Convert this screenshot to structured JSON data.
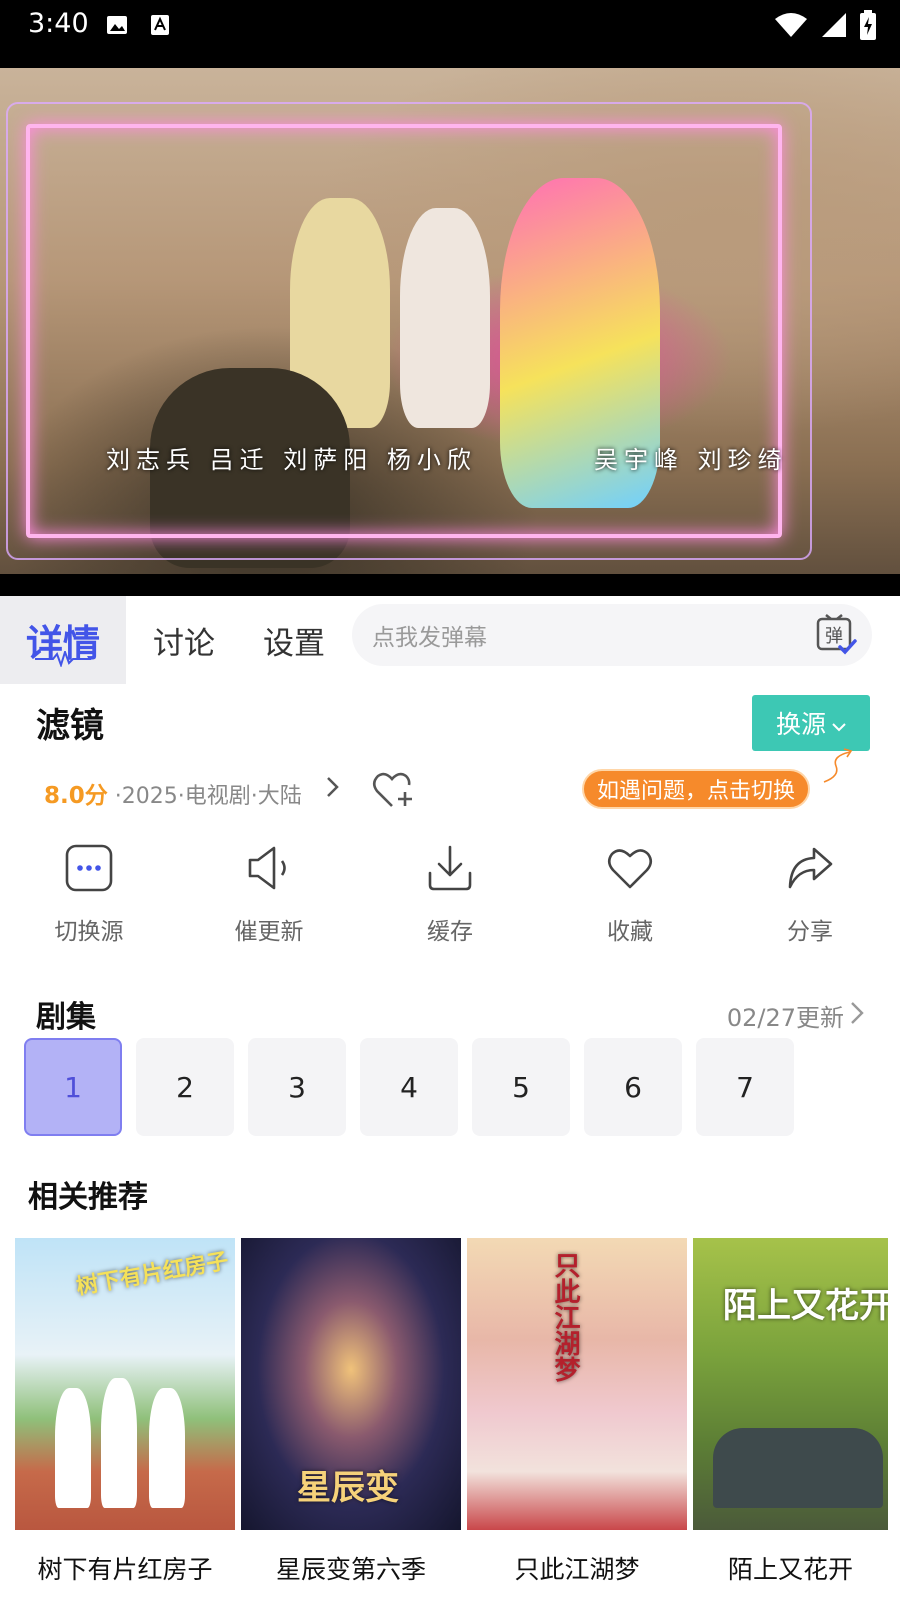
{
  "status_bar": {
    "time": "3:40",
    "icons": [
      "image-icon",
      "text-a-icon",
      "wifi-icon",
      "signal-icon",
      "battery-charging-icon"
    ]
  },
  "video": {
    "subtitle_left": "刘志兵 吕迁 刘萨阳 杨小欣",
    "subtitle_right": "吴宇峰 刘珍绮"
  },
  "tabs": {
    "details": "详情",
    "discuss": "讨论",
    "settings": "设置",
    "danmu_placeholder": "点我发弹幕",
    "danmu_icon_char": "弹"
  },
  "detail": {
    "title": "滤镜",
    "switch_source_label": "换源",
    "score": "8.0分",
    "meta": " ·2025·电视剧·大陆",
    "tip": "如遇问题，点击切换"
  },
  "actions": [
    {
      "label": "切换源",
      "icon": "more-dots-icon"
    },
    {
      "label": "催更新",
      "icon": "speaker-icon"
    },
    {
      "label": "缓存",
      "icon": "download-icon"
    },
    {
      "label": "收藏",
      "icon": "heart-icon"
    },
    {
      "label": "分享",
      "icon": "share-icon"
    }
  ],
  "episodes": {
    "title": "剧集",
    "update": "02/27更新",
    "list": [
      "1",
      "2",
      "3",
      "4",
      "5",
      "6",
      "7"
    ],
    "selected": "1"
  },
  "recommend": {
    "title": "相关推荐",
    "items": [
      {
        "name": "树下有片红房子",
        "poster_text": "树下有片红房子"
      },
      {
        "name": "星辰变第六季",
        "poster_text": "星辰变"
      },
      {
        "name": "只此江湖梦",
        "poster_text": "只此江湖梦"
      },
      {
        "name": "陌上又花开",
        "poster_text": "陌上又花开"
      }
    ]
  },
  "colors": {
    "accent": "#4355e8",
    "switch_button": "#3dc8b4",
    "tip_bubble": "#f68a2b",
    "score": "#f59a23",
    "episode_active": "#b3b2f6"
  }
}
